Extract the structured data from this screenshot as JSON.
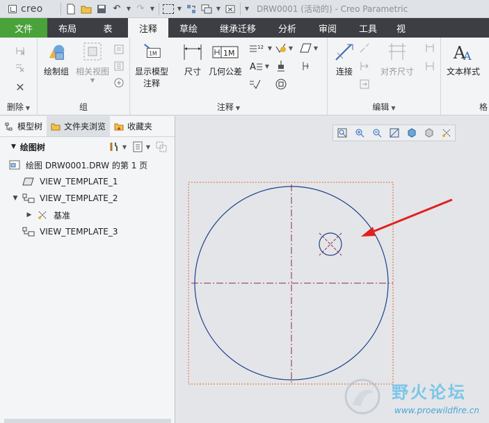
{
  "titlebar": {
    "app_name": "creo",
    "window_title": "DRW0001 (活动的) - Creo Parametric"
  },
  "tabs": [
    {
      "label": "文件"
    },
    {
      "label": "布局"
    },
    {
      "label": "表"
    },
    {
      "label": "注释"
    },
    {
      "label": "草绘"
    },
    {
      "label": "继承迁移"
    },
    {
      "label": "分析"
    },
    {
      "label": "审阅"
    },
    {
      "label": "工具"
    },
    {
      "label": "视"
    }
  ],
  "ribbon": {
    "groups": {
      "delete": "删除",
      "group": "组",
      "annotate": "注释",
      "edit": "编辑",
      "format_partial": "格"
    },
    "buttons": {
      "draw_group": "绘制组",
      "related_view": "相关视图",
      "show_model_annotations_1": "显示模型",
      "show_model_annotations_2": "注释",
      "dimension": "尺寸",
      "geo_tolerance": "几何公差",
      "connect": "连接",
      "align_dimensions": "对齐尺寸",
      "text_style": "文本样式"
    },
    "badges": {
      "one_m": "1M",
      "one_two": "12",
      "one_m_small": "1M"
    }
  },
  "panel": {
    "tabs": [
      {
        "label": "模型树"
      },
      {
        "label": "文件夹浏览"
      },
      {
        "label": "收藏夹"
      }
    ],
    "tree_title": "绘图树",
    "items": [
      {
        "label": "绘图 DRW0001.DRW 的第 1 页"
      },
      {
        "label": "VIEW_TEMPLATE_1"
      },
      {
        "label": "VIEW_TEMPLATE_2"
      },
      {
        "label": "基准"
      },
      {
        "label": "VIEW_TEMPLATE_3"
      }
    ]
  },
  "watermark": {
    "cn": "野火论坛",
    "url": "www.proewildfire.cn"
  },
  "colors": {
    "file_tab": "#4aa23a",
    "tab_bar": "#3c3e43",
    "circle": "#1c3f8c",
    "frame": "#e0652d",
    "arrow": "#e02020"
  }
}
